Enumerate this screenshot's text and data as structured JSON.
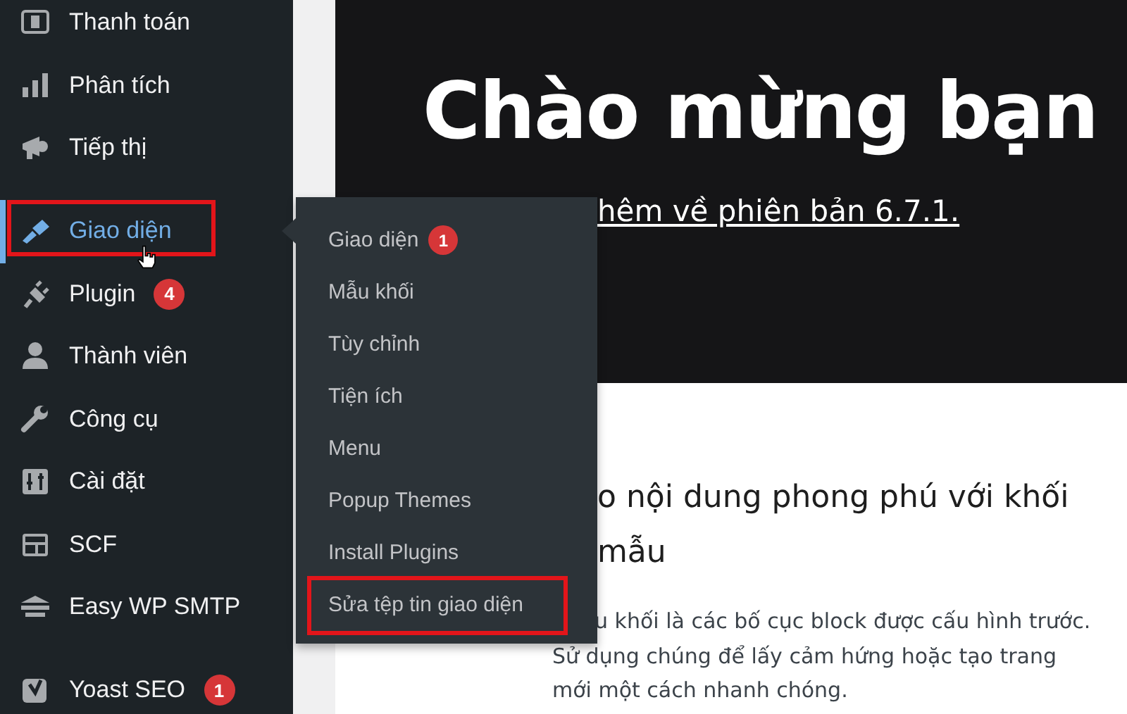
{
  "sidebar": {
    "items": [
      {
        "kind": "item",
        "label": "Thanh toán",
        "selected": false,
        "highlighted": false
      },
      {
        "kind": "item",
        "label": "Phân tích",
        "selected": false,
        "highlighted": false
      },
      {
        "kind": "item",
        "label": "Tiếp thị",
        "selected": false,
        "highlighted": false
      },
      {
        "kind": "separator"
      },
      {
        "kind": "item",
        "label": "Giao diện",
        "selected": true,
        "highlighted": true
      },
      {
        "kind": "item",
        "label": "Plugin",
        "badge": "4",
        "selected": false,
        "highlighted": false
      },
      {
        "kind": "item",
        "label": "Thành viên",
        "selected": false,
        "highlighted": false
      },
      {
        "kind": "item",
        "label": "Công cụ",
        "selected": false,
        "highlighted": false
      },
      {
        "kind": "item",
        "label": "Cài đặt",
        "selected": false,
        "highlighted": false
      },
      {
        "kind": "item",
        "label": "SCF",
        "selected": false,
        "highlighted": false
      },
      {
        "kind": "item",
        "label": "Easy WP SMTP",
        "selected": false,
        "highlighted": false
      },
      {
        "kind": "separator"
      },
      {
        "kind": "item",
        "label": "Yoast SEO",
        "badge": "1",
        "selected": false,
        "highlighted": false
      }
    ]
  },
  "flyout": {
    "items": [
      {
        "label": "Giao diện",
        "badge": "1",
        "highlighted": false
      },
      {
        "label": "Mẫu khối",
        "highlighted": false
      },
      {
        "label": "Tùy chỉnh",
        "highlighted": false
      },
      {
        "label": "Tiện ích",
        "highlighted": false
      },
      {
        "label": "Menu",
        "highlighted": false
      },
      {
        "label": "Popup Themes",
        "highlighted": false
      },
      {
        "label": "Install Plugins",
        "highlighted": false
      },
      {
        "label": "Sửa tệp tin giao diện",
        "highlighted": true
      }
    ]
  },
  "welcome": {
    "title": "Chào mừng bạn",
    "link": "hêm về phiên bản 6.7.1."
  },
  "section": {
    "heading_lines": [
      "o nội dung phong phú với khối",
      "mẫu"
    ],
    "description_lines": [
      "u khối là các bố cục block được cấu hình trước.",
      "Sử dụng chúng để lấy cảm hứng hoặc tạo trang",
      "mới một cách nhanh chóng."
    ]
  }
}
